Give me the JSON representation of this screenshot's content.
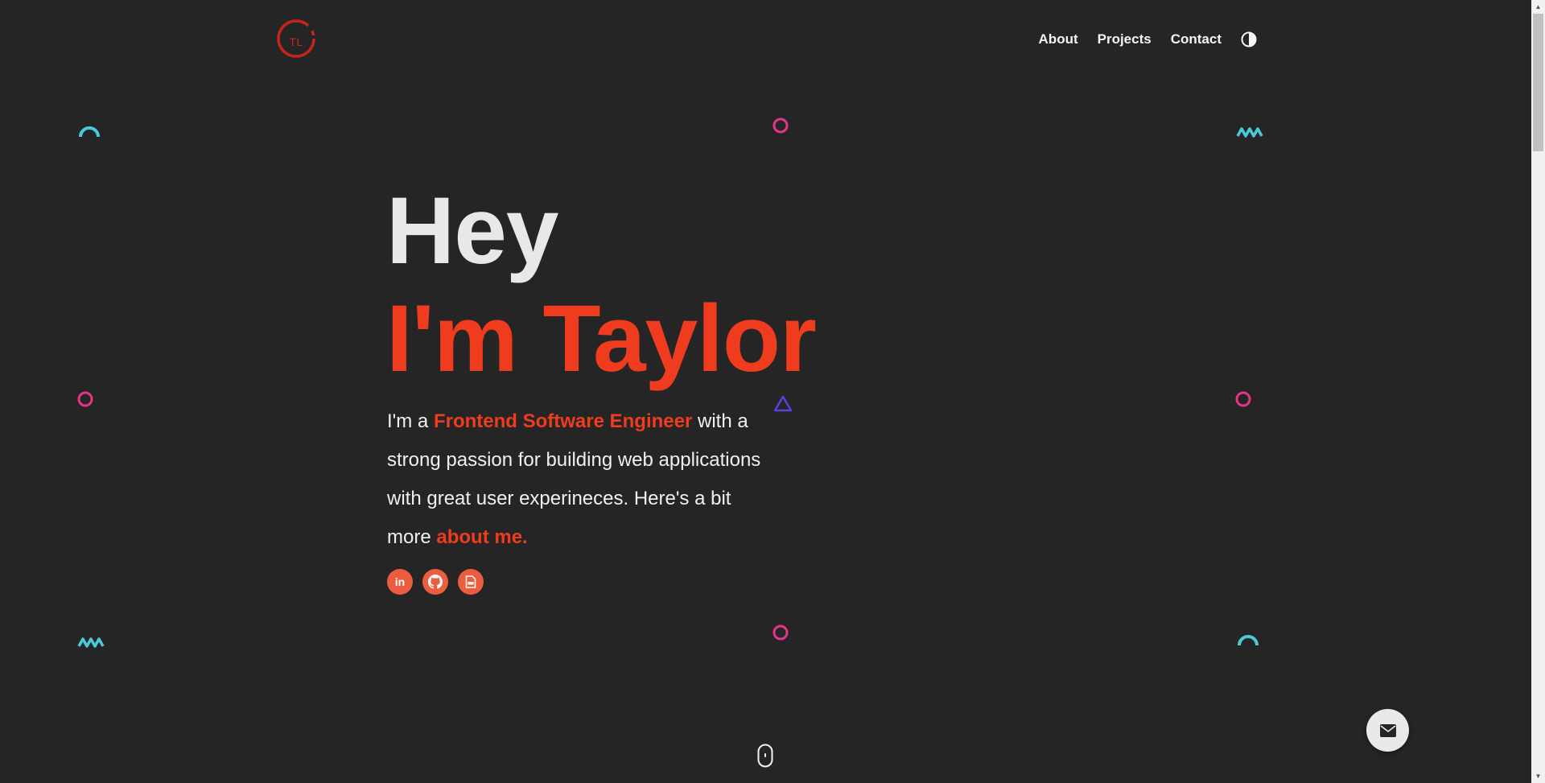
{
  "header": {
    "logo_text": "TL",
    "nav": [
      {
        "label": "About"
      },
      {
        "label": "Projects"
      },
      {
        "label": "Contact"
      }
    ],
    "theme_toggle_icon": "half-circle-icon"
  },
  "hero": {
    "greeting": "Hey",
    "name_line": "I'm Taylor",
    "desc_prefix": "I'm a ",
    "desc_role": "Frontend Software Engineer",
    "desc_middle": " with a strong passion for building web applications with great user experineces. Here's a bit more ",
    "desc_link": "about me.",
    "socials": [
      {
        "icon": "linkedin-icon",
        "glyph": "in"
      },
      {
        "icon": "github-icon"
      },
      {
        "icon": "pdf-resume-icon"
      }
    ]
  },
  "floating_actions": {
    "mail_icon": "envelope-icon",
    "scroll_icon": "mouse-scroll-icon"
  },
  "colors": {
    "background": "#252525",
    "accent": "#ef3b1e",
    "social_bg": "#ec5d3f",
    "shape_pink": "#e8338b",
    "shape_cyan": "#4cc9d9",
    "shape_purple": "#5b3fe0"
  }
}
